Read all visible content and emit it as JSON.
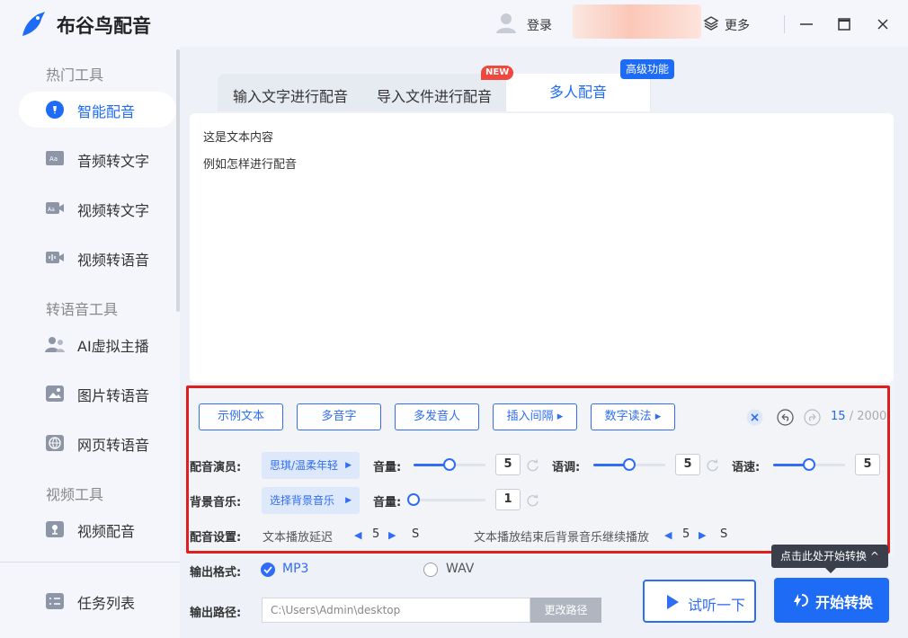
{
  "app": {
    "title": "布谷鸟配音",
    "login": "登录",
    "more": "更多"
  },
  "sidebar": {
    "sections": [
      "热门工具",
      "转语音工具",
      "视频工具"
    ],
    "items": [
      {
        "label": "智能配音",
        "icon": "smart-dubbing-icon",
        "active": true
      },
      {
        "label": "音频转文字",
        "icon": "audio-to-text-icon"
      },
      {
        "label": "视频转文字",
        "icon": "video-to-text-icon"
      },
      {
        "label": "视频转语音",
        "icon": "video-to-speech-icon"
      },
      {
        "label": "AI虚拟主播",
        "icon": "ai-anchor-icon"
      },
      {
        "label": "图片转语音",
        "icon": "image-to-speech-icon"
      },
      {
        "label": "网页转语音",
        "icon": "webpage-to-speech-icon"
      },
      {
        "label": "视频配音",
        "icon": "video-dubbing-icon"
      }
    ],
    "task_list": "任务列表"
  },
  "tabs": [
    {
      "label": "输入文字进行配音"
    },
    {
      "label": "导入文件进行配音",
      "badge": "NEW"
    },
    {
      "label": "多人配音",
      "badge": "高级功能",
      "active": true
    }
  ],
  "editor": {
    "lines": [
      "这是文本内容",
      "例如怎样进行配音"
    ]
  },
  "toolbar": {
    "buttons": [
      "示例文本",
      "多音字",
      "多发音人",
      "插入间隔 ▸",
      "数字读法 ▸"
    ],
    "count_current": "15",
    "count_max": "/ 2000"
  },
  "settings": {
    "actor_label": "配音演员:",
    "actor_value": "思琪/温柔年轻",
    "volume_label": "音量:",
    "volume": "5",
    "volume_level": 0.5,
    "pitch_label": "语调:",
    "pitch": "5",
    "pitch_level": 0.5,
    "speed_label": "语速:",
    "speed": "5",
    "speed_level": 0.5,
    "bgm_label": "背景音乐:",
    "bgm_value": "选择背景音乐",
    "bgm_volume_label": "音量:",
    "bgm_volume": "1",
    "bgm_volume_level": 0.0,
    "dub_label": "配音设置:",
    "delay_label": "文本播放延迟",
    "delay_value": "5",
    "unit": "S",
    "continue_label": "文本播放结束后背景音乐继续播放",
    "continue_value": "5"
  },
  "output": {
    "format_label": "输出格式:",
    "formats": [
      "MP3",
      "WAV"
    ],
    "selected": "MP3",
    "path_label": "输出路径:",
    "path_value": "C:\\Users\\Admin\\desktop",
    "change_path": "更改路径"
  },
  "actions": {
    "try": "试听一下",
    "start": "开始转换",
    "tooltip": "点击此处开始转换 ^"
  },
  "colors": {
    "accent": "#1e6bf5",
    "highlight": "#e01e1e"
  }
}
